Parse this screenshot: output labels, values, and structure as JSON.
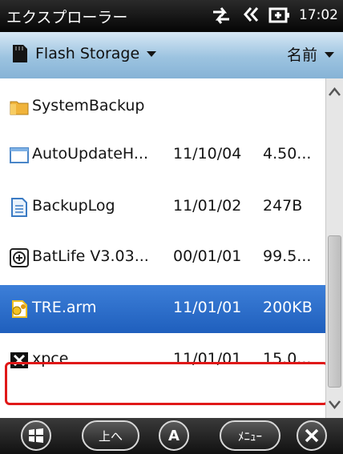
{
  "status": {
    "title": "エクスプローラー",
    "time": "17:02",
    "icons": [
      "sync-arrows-icon",
      "speaker-icon",
      "battery-plug-icon"
    ]
  },
  "header": {
    "location": "Flash Storage",
    "sort_label": "名前"
  },
  "files": [
    {
      "name": "SystemBackup",
      "date": "",
      "size": "",
      "icon": "folder-icon",
      "selected": false
    },
    {
      "name": "AutoUpdateH...",
      "date": "11/10/04",
      "size": "4.50...",
      "icon": "window-file-icon",
      "selected": false
    },
    {
      "name": "BackupLog",
      "date": "11/01/02",
      "size": "247B",
      "icon": "text-document-icon",
      "selected": false
    },
    {
      "name": "BatLife V3.03...",
      "date": "00/01/01",
      "size": "99.5...",
      "icon": "app-icon",
      "selected": false
    },
    {
      "name": "TRE.arm",
      "date": "11/01/01",
      "size": "200KB",
      "icon": "settings-file-icon",
      "selected": true
    },
    {
      "name": "xpce",
      "date": "11/01/01",
      "size": "15.0...",
      "icon": "x-app-icon",
      "selected": false
    }
  ],
  "toolbar": {
    "up_label": "上へ",
    "a_label": "A",
    "menu_label": "ﾒﾆｭｰ"
  },
  "colors": {
    "selection": "#2a6fcf",
    "highlight_border": "#e01818",
    "header_bg": "#a9cbe6"
  }
}
